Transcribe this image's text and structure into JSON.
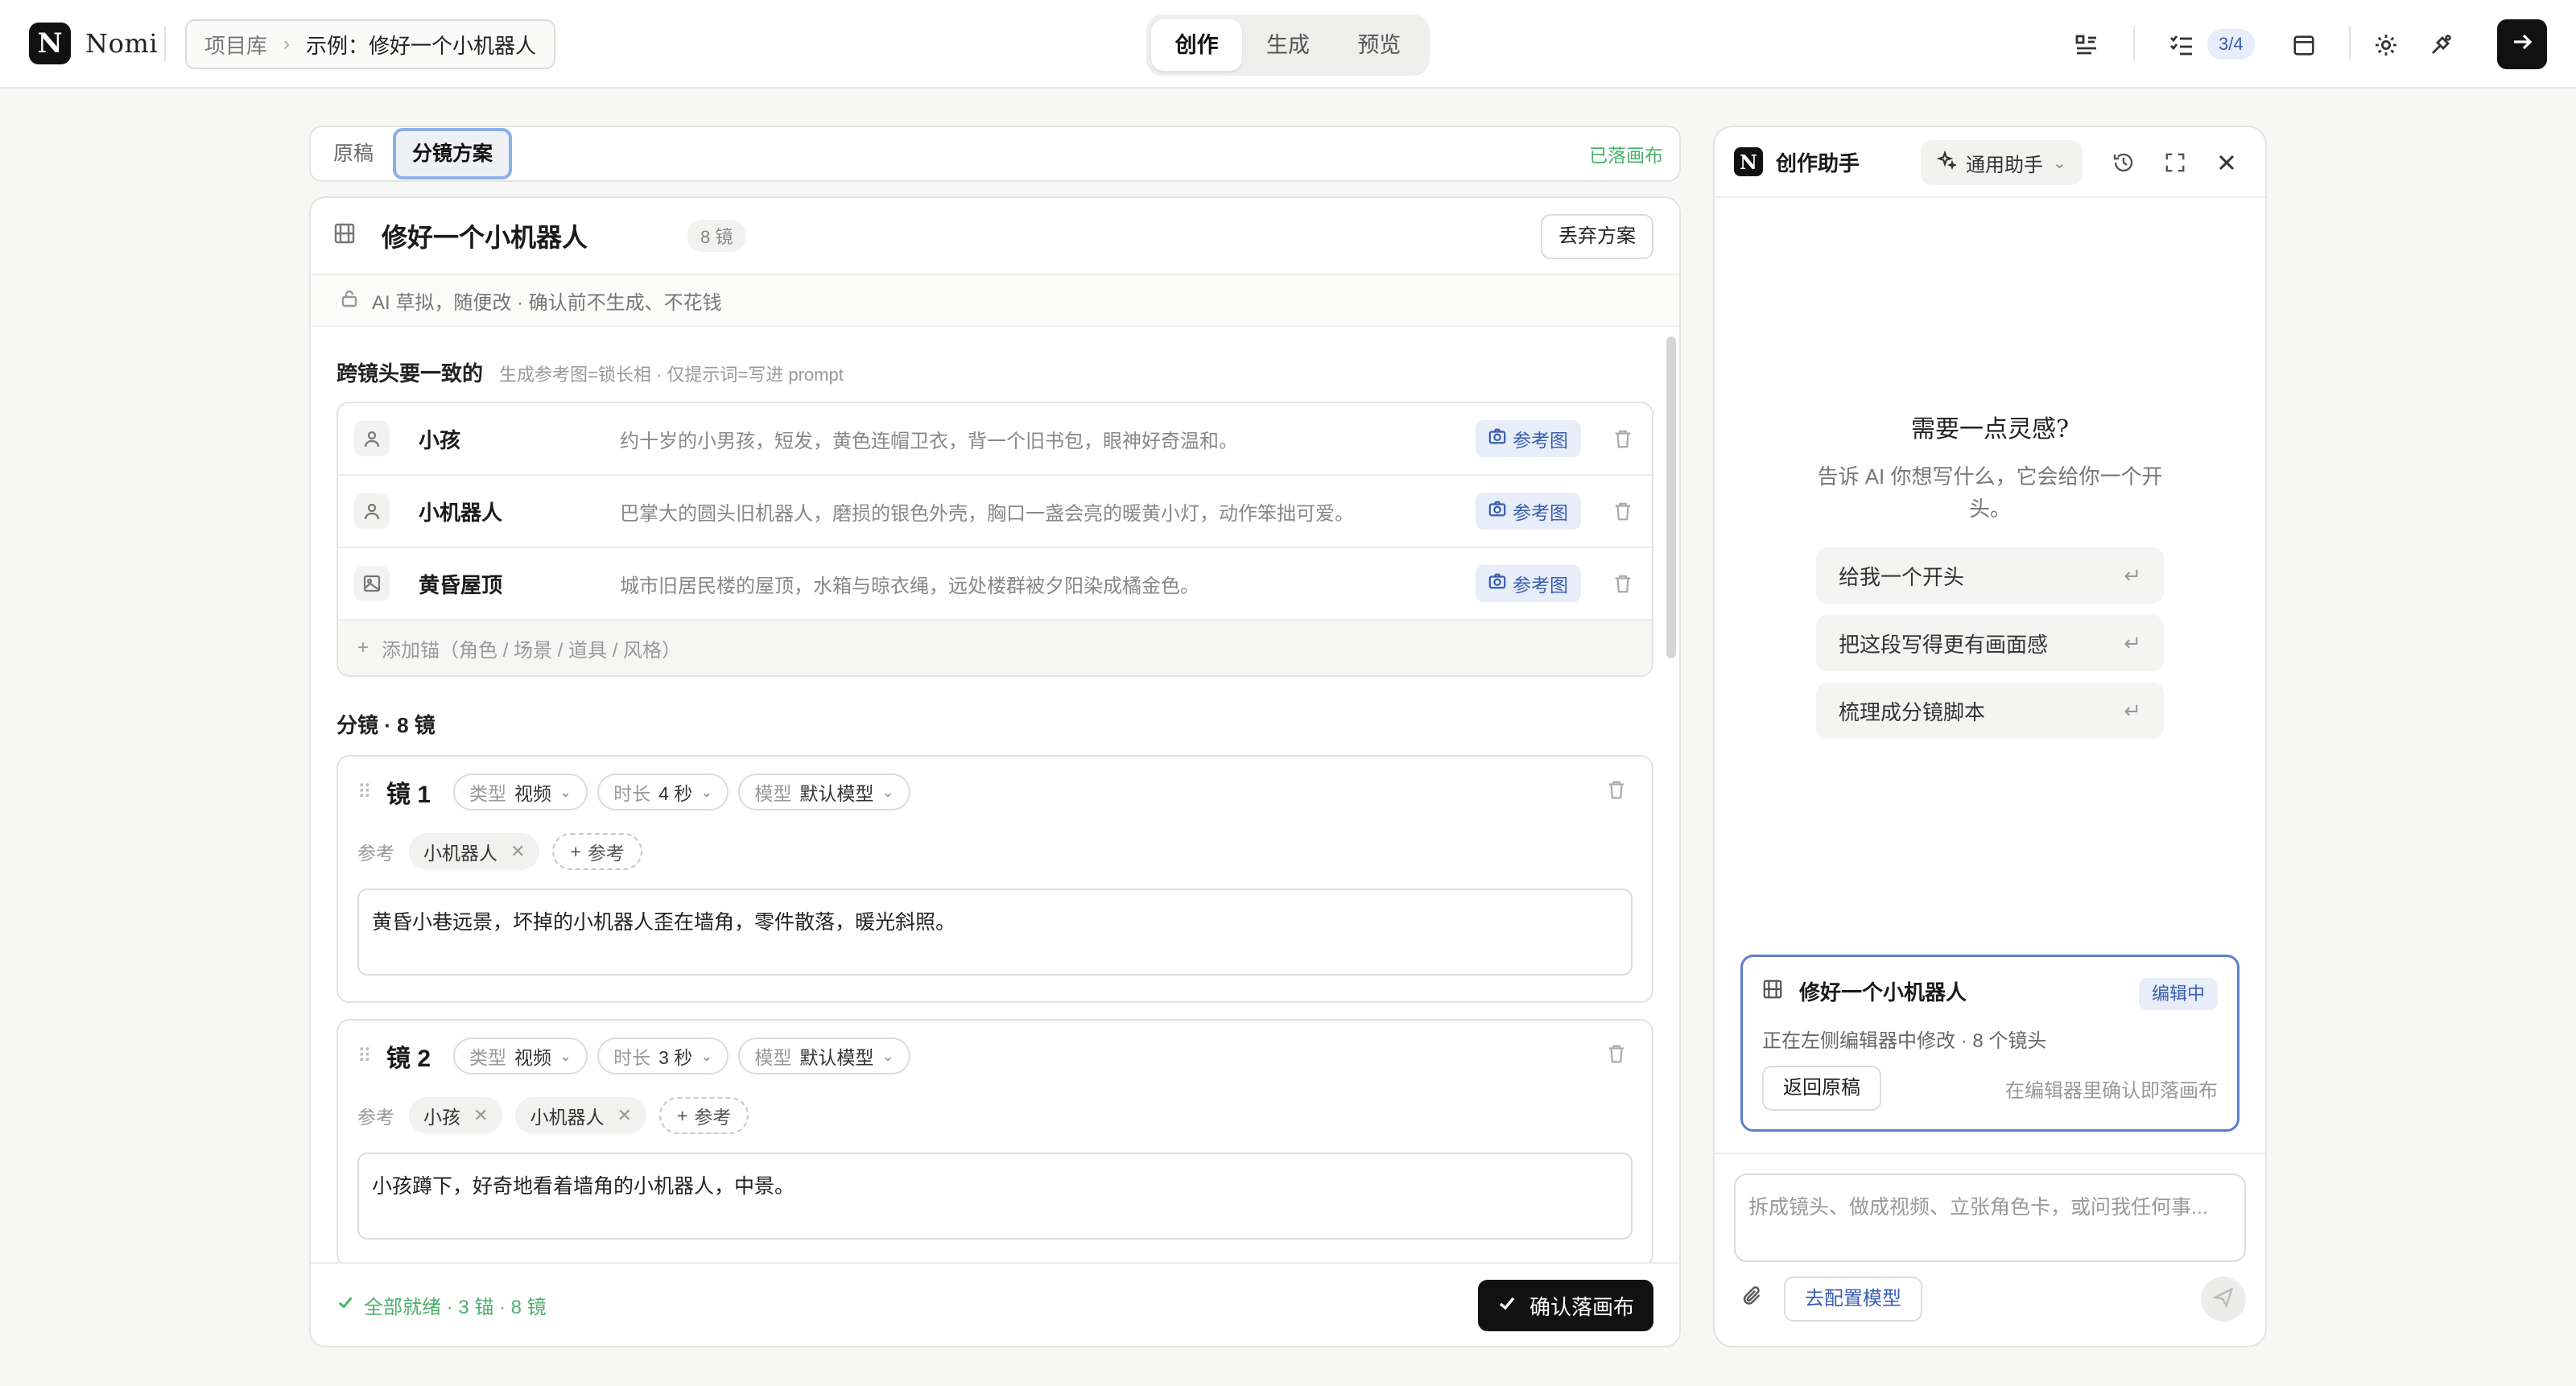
{
  "app": {
    "logo_letter": "N",
    "name": "Nomi"
  },
  "breadcrumb": {
    "root": "项目库",
    "current": "示例：修好一个小机器人"
  },
  "modes": [
    "创作",
    "生成",
    "预览"
  ],
  "toolbar": {
    "tasks_badge": "3/4"
  },
  "editor": {
    "tabs": {
      "draft": "原稿",
      "storyboard": "分镜方案"
    },
    "landed": "已落画布",
    "title": "修好一个小机器人",
    "shot_count": "8 镜",
    "discard_label": "丢弃方案",
    "note": "AI 草拟，随便改 · 确认前不生成、不花钱",
    "anchors_title": "跨镜头要一致的",
    "anchors_hint": "生成参考图=锁长相 · 仅提示词=写进 prompt",
    "anchors": [
      {
        "name": "小孩",
        "desc": "约十岁的小男孩，短发，黄色连帽卫衣，背一个旧书包，眼神好奇温和。",
        "ref": "参考图",
        "icon": "person-icon"
      },
      {
        "name": "小机器人",
        "desc": "巴掌大的圆头旧机器人，磨损的银色外壳，胸口一盏会亮的暖黄小灯，动作笨拙可爱。",
        "ref": "参考图",
        "icon": "person-icon"
      },
      {
        "name": "黄昏屋顶",
        "desc": "城市旧居民楼的屋顶，水箱与晾衣绳，远处楼群被夕阳染成橘金色。",
        "ref": "参考图",
        "icon": "image-icon"
      }
    ],
    "add_anchor": "添加锚（角色 / 场景 / 道具 / 风格）",
    "shots_title": "分镜 · 8 镜",
    "shots": [
      {
        "name": "镜 1",
        "type_k": "类型",
        "type_v": "视频",
        "dur_k": "时长",
        "dur_v": "4 秒",
        "model_k": "模型",
        "model_v": "默认模型",
        "ref_label": "参考",
        "refs": [
          "小机器人"
        ],
        "add_ref": "参考",
        "text": "黄昏小巷远景，坏掉的小机器人歪在墙角，零件散落，暖光斜照。"
      },
      {
        "name": "镜 2",
        "type_k": "类型",
        "type_v": "视频",
        "dur_k": "时长",
        "dur_v": "3 秒",
        "model_k": "模型",
        "model_v": "默认模型",
        "ref_label": "参考",
        "refs": [
          "小孩",
          "小机器人"
        ],
        "add_ref": "参考",
        "text": "小孩蹲下，好奇地看着墙角的小机器人，中景。"
      }
    ],
    "ready": "全部就绪 · 3 锚 · 8 镜",
    "confirm": "确认落画布"
  },
  "assistant": {
    "title": "创作助手",
    "mode": "通用助手",
    "inspiration_title": "需要一点灵感?",
    "inspiration_sub": "告诉 AI 你想写什么，它会给你一个开头。",
    "suggestions": [
      "给我一个开头",
      "把这段写得更有画面感",
      "梳理成分镜脚本"
    ],
    "context": {
      "title": "修好一个小机器人",
      "badge": "编辑中",
      "sub": "正在左侧编辑器中修改 · 8 个镜头",
      "back": "返回原稿",
      "hint": "在编辑器里确认即落画布"
    },
    "input_placeholder": "拆成镜头、做成视频、立张角色卡，或问我任何事...",
    "config_model": "去配置模型"
  },
  "colors": {
    "accent": "#3a5db0",
    "success": "#4caf6e",
    "dark": "#111111"
  }
}
